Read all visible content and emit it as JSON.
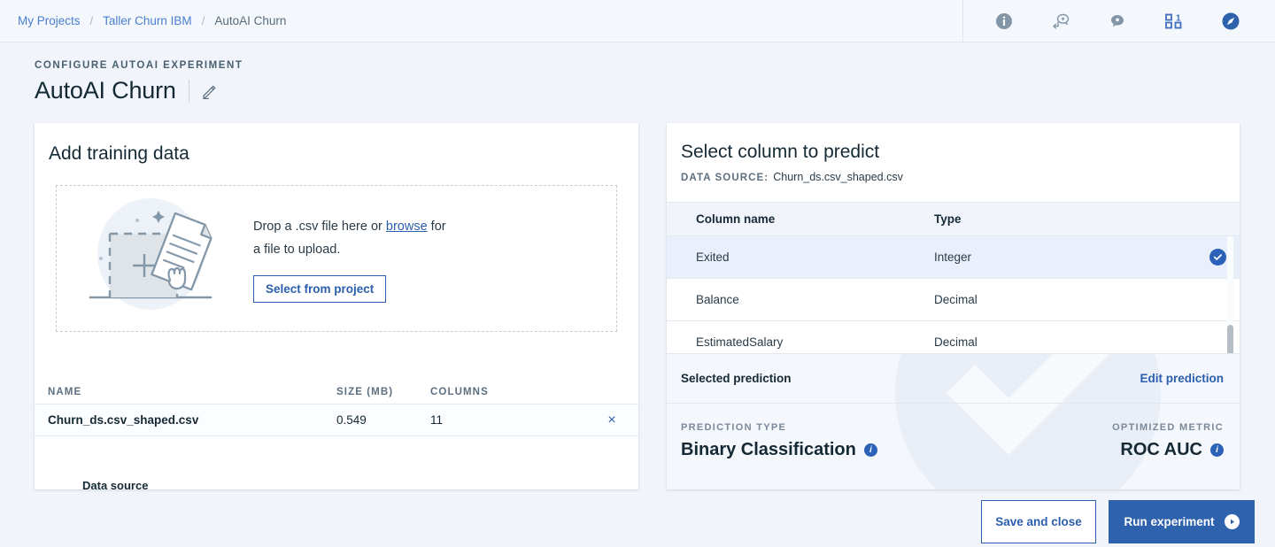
{
  "breadcrumb": {
    "items": [
      {
        "label": "My Projects",
        "current": false
      },
      {
        "label": "Taller Churn IBM",
        "current": false
      },
      {
        "label": "AutoAI Churn",
        "current": true
      }
    ],
    "separator": "/"
  },
  "top_icons": [
    {
      "name": "info-icon"
    },
    {
      "name": "comment-reply-icon"
    },
    {
      "name": "comment-icon"
    },
    {
      "name": "apps-grid-icon",
      "badge": "1"
    },
    {
      "name": "compass-icon"
    }
  ],
  "header": {
    "eyebrow": "CONFIGURE AUTOAI EXPERIMENT",
    "title": "AutoAI Churn",
    "edit_icon": "pencil-icon"
  },
  "training_data": {
    "title": "Add training data",
    "drop_text_before": "Drop a .csv file here or ",
    "drop_link": "browse",
    "drop_text_after": " for",
    "drop_line2": "a file to upload.",
    "select_button": "Select from project",
    "data_source_label": "Data source",
    "columns": [
      "NAME",
      "SIZE (MB)",
      "COLUMNS"
    ],
    "rows": [
      {
        "name": "Churn_ds.csv_shaped.csv",
        "size": "0.549",
        "columns": "11",
        "remove": "×"
      }
    ]
  },
  "predict_panel": {
    "title": "Select column to predict",
    "source_label": "DATA SOURCE:",
    "source_value": "Churn_ds.csv_shaped.csv",
    "columns": [
      "Column name",
      "Type"
    ],
    "rows": [
      {
        "name": "Exited",
        "type": "Integer",
        "selected": true
      },
      {
        "name": "Balance",
        "type": "Decimal",
        "selected": false
      },
      {
        "name": "EstimatedSalary",
        "type": "Decimal",
        "selected": false
      }
    ]
  },
  "selected_prediction": {
    "label": "Selected prediction",
    "edit_link": "Edit prediction",
    "prediction_type_label": "PREDICTION TYPE",
    "prediction_type_value": "Binary Classification",
    "optimized_metric_label": "OPTIMIZED METRIC",
    "optimized_metric_value": "ROC AUC",
    "info_glyph": "i"
  },
  "footer": {
    "save_label": "Save and close",
    "run_label": "Run experiment"
  },
  "colors": {
    "accent_blue": "#2b5fad",
    "primary_button": "#2f62ac",
    "page_bg": "#f1f5fb",
    "card_bg": "#ffffff",
    "selected_row": "#e9f0fb",
    "text_dark": "#152935",
    "text_muted": "#5c6f80"
  }
}
